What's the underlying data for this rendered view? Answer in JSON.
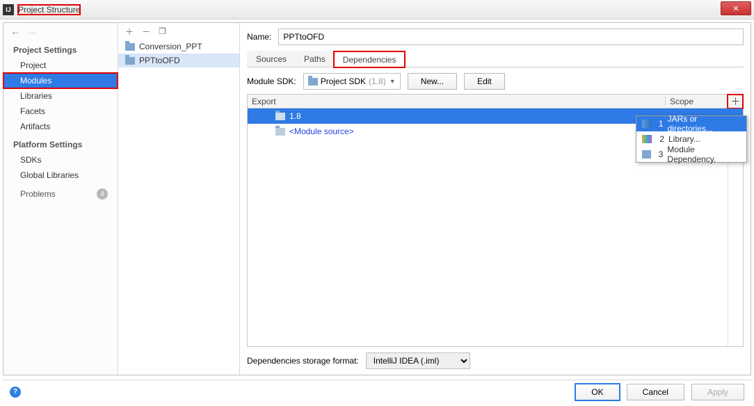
{
  "window": {
    "title": "Project Structure"
  },
  "sidebar": {
    "section1": "Project Settings",
    "items1": [
      "Project",
      "Modules",
      "Libraries",
      "Facets",
      "Artifacts"
    ],
    "selected": "Modules",
    "section2": "Platform Settings",
    "items2": [
      "SDKs",
      "Global Libraries"
    ],
    "problems_label": "Problems",
    "problems_count": "4"
  },
  "modules": {
    "items": [
      "Conversion_PPT",
      "PPTtoOFD"
    ],
    "selected": "PPTtoOFD"
  },
  "main": {
    "name_label": "Name:",
    "name_value": "PPTtoOFD",
    "tabs": [
      "Sources",
      "Paths",
      "Dependencies"
    ],
    "active_tab": "Dependencies",
    "sdk_label": "Module SDK:",
    "sdk_value": "Project SDK",
    "sdk_ver": "(1.8)",
    "new_btn": "New...",
    "edit_btn": "Edit",
    "export_col": "Export",
    "scope_col": "Scope",
    "dep_rows": [
      {
        "label": "1.8",
        "selected": true
      },
      {
        "label": "<Module source>",
        "selected": false,
        "src": true
      }
    ],
    "popup": [
      {
        "n": "1",
        "label": "JARs or directories...",
        "sel": true,
        "ic": "jar",
        "u": "J"
      },
      {
        "n": "2",
        "label": "Library...",
        "sel": false,
        "ic": "lib",
        "u": "L"
      },
      {
        "n": "3",
        "label": "Module Dependency.",
        "sel": false,
        "ic": "mod",
        "u": "M"
      }
    ],
    "storage_label": "Dependencies storage format:",
    "storage_value": "IntelliJ IDEA (.iml)"
  },
  "footer": {
    "ok": "OK",
    "cancel": "Cancel",
    "apply": "Apply"
  }
}
